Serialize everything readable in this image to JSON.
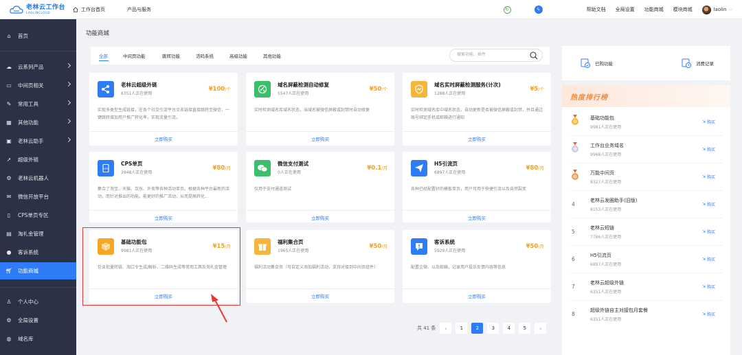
{
  "header": {
    "logo_main": "老林云工作台",
    "logo_sub": "LAOLINCLOUD",
    "nav": [
      "工作台首页",
      "产品与服务"
    ],
    "right_links": [
      "帮助文档",
      "全局设置",
      "功能商城",
      "模块商城"
    ],
    "username": "laolin"
  },
  "sidebar": {
    "items": [
      {
        "label": "首页",
        "icon": "home-icon"
      },
      {
        "label": "云系列产品",
        "icon": "cloud-icon"
      },
      {
        "label": "中间页相关",
        "icon": "page-icon"
      },
      {
        "label": "常用工具",
        "icon": "tool-icon"
      },
      {
        "label": "其他功能",
        "icon": "grid-icon"
      },
      {
        "label": "老林云助手",
        "icon": "robot-icon"
      },
      {
        "label": "超级外链",
        "icon": "link-icon"
      },
      {
        "label": "老林云机器人",
        "icon": "bot-icon"
      },
      {
        "label": "微信开放平台",
        "icon": "wechat-icon"
      },
      {
        "label": "CPS单页专区",
        "icon": "cps-icon"
      },
      {
        "label": "淘礼金管理",
        "icon": "gift-icon"
      },
      {
        "label": "客诉系统",
        "icon": "user-icon"
      },
      {
        "label": "功能商城",
        "icon": "cart-icon"
      },
      {
        "label": "个人中心",
        "icon": "person-icon"
      },
      {
        "label": "全局设置",
        "icon": "settings-icon"
      },
      {
        "label": "域名库",
        "icon": "globe-icon"
      }
    ]
  },
  "main": {
    "title": "功能商城",
    "tabs": [
      "全部",
      "中间页功能",
      "跳转功能",
      "活码系统",
      "高级功能",
      "其他功能"
    ],
    "search_placeholder": "搜索功能、插件",
    "buy_label": "立即购买",
    "cards": [
      {
        "title": "老林云超级外链",
        "users": "6351人正在使用",
        "price": "¥100",
        "unit": "/个",
        "desc": "实现多类型生成链接，在各个社交引流平台点击链接直接跳转至微信，一键跳转增加用户推广转化率，实现流量引流。",
        "icon": "share-icon",
        "color": "#2f7df6"
      },
      {
        "title": "域名屏蔽检测自动修复",
        "users": "5547人正在使用",
        "price": "¥50",
        "unit": "/个",
        "desc": "实时检测域名库域名状态，当域名被微信屏蔽或封禁时自动修复",
        "icon": "repair-icon",
        "color": "#3bbf6a"
      },
      {
        "title": "域名实时屏蔽检测服务(计次)",
        "users": "1288人正在使用",
        "price": "¥5",
        "unit": "/个",
        "desc": "实时检测域名库中域名状态，自动更新是否被微信屏蔽或封禁，并且通过账号绑定手机或邮箱进行通知",
        "icon": "shield-icon",
        "color": "#f5b63b"
      },
      {
        "title": "CPS单页",
        "users": "3948人正在使用",
        "price": "¥80",
        "unit": "/月",
        "desc": "集合了淘宝、天猫、京东、外卖等各种活动单页。根据各种平台最新的活动，而针对推出的功能。能更好的推广活动，从而提高转化...",
        "icon": "cps-icon",
        "color": "#2f7df6"
      },
      {
        "title": "微信支付测试",
        "users": "0人正在使用",
        "price": "¥0.1",
        "unit": "/月",
        "desc": "仅用于支付通道测试",
        "icon": "wechat-icon",
        "color": "#3bbf6a"
      },
      {
        "title": "H5引流页",
        "users": "6897人正在使用",
        "price": "¥80",
        "unit": "/月",
        "desc": "各种已经配置好的模板单页，用户可用于快捷引流以及自然裂变",
        "icon": "send-icon",
        "color": "#2f7df6"
      },
      {
        "title": "基础功能包",
        "users": "9981人正在使用",
        "price": "¥15",
        "unit": "/月",
        "desc": "包含批量转链、淘口令生成/解析、二维码生成等常用工具及淘礼金管理",
        "icon": "box-icon",
        "color": "#f5a623"
      },
      {
        "title": "福利集合页",
        "users": "1965人正在使用",
        "price": "¥50",
        "unit": "/月",
        "desc": "福利活动集合页（可自定义添加福利活动，支持对接到中间页组件）",
        "icon": "gift-box-icon",
        "color": "#f5b63b"
      },
      {
        "title": "客诉系统",
        "users": "5929人正在使用",
        "price": "¥50",
        "unit": "/月",
        "desc": "配置企微、以及邮箱，记录用户投诉反馈内容等信息",
        "icon": "alert-icon",
        "color": "#2f7df6"
      }
    ]
  },
  "pagination": {
    "total": "共 41 条",
    "pages": [
      "1",
      "2",
      "3",
      "4",
      "5"
    ],
    "current": "2"
  },
  "right": {
    "purchased": "已购功能",
    "consumption": "消费记录",
    "rank_title": "热度排行榜",
    "buy_label": "购买",
    "ranks": [
      {
        "num": "1",
        "name": "基础功能包",
        "users": "9981人正在使用"
      },
      {
        "num": "2",
        "name": "工作台业务域名",
        "users": "9968人正在使用"
      },
      {
        "num": "3",
        "name": "万能中间页",
        "users": "8327人正在使用"
      },
      {
        "num": "4",
        "name": "老林云发圈助手(旧版)",
        "users": "8153人正在使用"
      },
      {
        "num": "5",
        "name": "老林云短链",
        "users": "7786人正在使用"
      },
      {
        "num": "6",
        "name": "H5引流页",
        "users": "6897人正在使用"
      },
      {
        "num": "7",
        "name": "老林云超级外链",
        "users": "6351人正在使用"
      },
      {
        "num": "8",
        "name": "超级外链自主对接包月套餐",
        "users": "6351人正在使用"
      }
    ]
  }
}
